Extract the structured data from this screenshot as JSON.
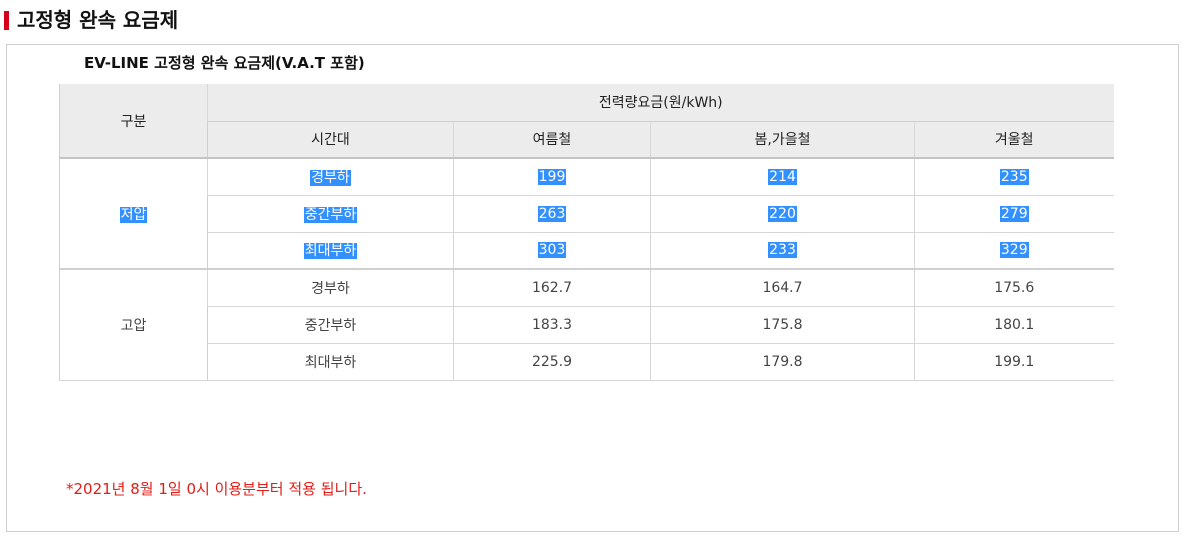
{
  "header": {
    "title": "고정형 완속 요금제"
  },
  "panel": {
    "table_title": "EV-LINE 고정형 완속 요금제(V.A.T 포함)",
    "footnote": "*2021년 8월 1일 0시 이용분부터 적용 됩니다."
  },
  "table": {
    "head": {
      "category": "구분",
      "group_header": "전력량요금(원/kWh)",
      "time_slot": "시간대",
      "summer": "여름철",
      "spring_fall": "봄,가을철",
      "winter": "겨울철"
    },
    "groups": [
      {
        "name": "저압",
        "selected": true,
        "rows": [
          {
            "time": "경부하",
            "summer": "199",
            "spring_fall": "214",
            "winter": "235"
          },
          {
            "time": "중간부하",
            "summer": "263",
            "spring_fall": "220",
            "winter": "279"
          },
          {
            "time": "최대부하",
            "summer": "303",
            "spring_fall": "233",
            "winter": "329"
          }
        ]
      },
      {
        "name": "고압",
        "selected": false,
        "rows": [
          {
            "time": "경부하",
            "summer": "162.7",
            "spring_fall": "164.7",
            "winter": "175.6"
          },
          {
            "time": "중간부하",
            "summer": "183.3",
            "spring_fall": "175.8",
            "winter": "180.1"
          },
          {
            "time": "최대부하",
            "summer": "225.9",
            "spring_fall": "179.8",
            "winter": "199.1"
          }
        ]
      }
    ]
  },
  "colors": {
    "accent_red": "#d50019",
    "note_red": "#e41b17",
    "selection_blue": "#3390ff",
    "header_gray": "#ececec"
  }
}
